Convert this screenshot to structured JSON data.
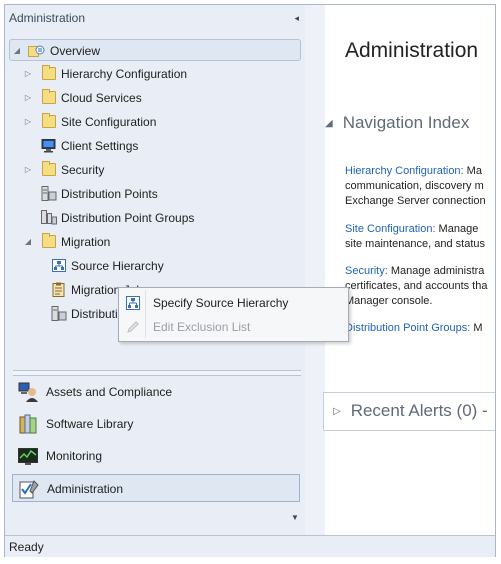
{
  "left_pane": {
    "title": "Administration",
    "collapse_glyph": "◂",
    "tree": [
      {
        "label": "Overview",
        "icon": "overview-icon",
        "expander": "◢",
        "selected": true
      },
      {
        "label": "Hierarchy Configuration",
        "icon": "folder-icon",
        "expander": "▷"
      },
      {
        "label": "Cloud Services",
        "icon": "folder-icon",
        "expander": "▷"
      },
      {
        "label": "Site Configuration",
        "icon": "folder-icon",
        "expander": "▷"
      },
      {
        "label": "Client Settings",
        "icon": "client-settings-icon",
        "expander": ""
      },
      {
        "label": "Security",
        "icon": "folder-icon",
        "expander": "▷"
      },
      {
        "label": "Distribution Points",
        "icon": "distribution-points-icon",
        "expander": ""
      },
      {
        "label": "Distribution Point Groups",
        "icon": "distribution-point-groups-icon",
        "expander": ""
      },
      {
        "label": "Migration",
        "icon": "folder-icon",
        "expander": "◢"
      },
      {
        "label": "Source Hierarchy",
        "icon": "source-hierarchy-icon",
        "expander": ""
      },
      {
        "label": "Migration Jobs",
        "icon": "migration-jobs-icon",
        "expander": ""
      },
      {
        "label": "Distribution Point Upgrades",
        "icon": "distribution-point-upgrades-icon",
        "expander": ""
      }
    ],
    "workspaces": [
      {
        "label": "Assets and Compliance",
        "icon": "assets-compliance-icon"
      },
      {
        "label": "Software Library",
        "icon": "software-library-icon"
      },
      {
        "label": "Monitoring",
        "icon": "monitoring-icon"
      },
      {
        "label": "Administration",
        "icon": "administration-icon",
        "selected": true
      }
    ],
    "scroll_glyph": "▼"
  },
  "context_menu": {
    "items": [
      {
        "label": "Specify Source Hierarchy",
        "icon": "hierarchy-icon",
        "enabled": true
      },
      {
        "label": "Edit Exclusion List",
        "icon": "pencil-icon",
        "enabled": false
      }
    ]
  },
  "right_pane": {
    "title": "Administration",
    "navigation_index": {
      "heading": "Navigation Index",
      "arrow": "◢",
      "entries": [
        {
          "link": "Hierarchy Configuration:",
          "lines": [
            " Ma",
            "communication, discovery m",
            "Exchange Server connection"
          ]
        },
        {
          "link": "Site Configuration:",
          "lines": [
            " Manage",
            "site maintenance, and status"
          ]
        },
        {
          "link": "Security:",
          "lines": [
            " Manage administra",
            "certificates, and accounts tha",
            "Manager console."
          ]
        },
        {
          "link": "Distribution Point Groups:",
          "lines": [
            " M"
          ]
        }
      ]
    },
    "recent_alerts": {
      "heading": "Recent Alerts (0) -",
      "arrow": "▷"
    }
  },
  "status_bar": {
    "text": "Ready"
  }
}
